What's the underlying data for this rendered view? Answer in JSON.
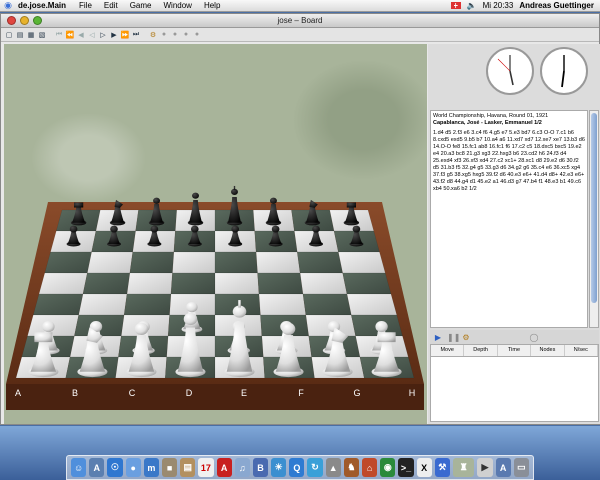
{
  "menubar": {
    "app_name": "de.jose.Main",
    "menus": [
      "File",
      "Edit",
      "Game",
      "Window",
      "Help"
    ],
    "clock": "Mi 20:33",
    "user": "Andreas Guettinger"
  },
  "window": {
    "title": "jose – Board"
  },
  "board": {
    "files": [
      "A",
      "B",
      "C",
      "D",
      "E",
      "F",
      "G",
      "H"
    ]
  },
  "game": {
    "event": "World Championship, Havana, Round 01, 1921",
    "players": "Capablanca, José - Lasker, Emmanuel  1/2",
    "moves": "1.d4 d5 2.f3 e6 3.c4 f6 4.g5 e7 5.e3 bd7 6.c3 O-O 7.c1 b6 8.cxd5 exd5 9.b5 b7 10.a4 a6 11.xd7 xd7 12.xe7 xe7 13.b3 d6 14.O-O fe8 15.fc1 ab8 16.fc1 f6 17.c2 c5 18.dxc5 bxc5 19.e2 e4 20.a3 bc8 21.g3 xg3 22.hxg3 b6 23.cd2 h6 24.f3 d4 25.exd4 xf3 26.xf3 xd4 27.c2 xc1+ 28.xc1 d8 29.e2 d6 30.f2 d5 31.b3 f5 32.g4 g5 33.g3 d6 34.g2 g6 35.c4 e6 36.xc5 xg4 37.f3 g5 38.xg5 hxg5 39.f2 d6 40.e3 e6+ 41.d4 d8+ 42.e3 e6+ 43.f2 d8 44.g4 d1 45.e2 a1 46.d3 g7 47.b4 f1 48.e3 b1 49.c6 xb4 50.xa6 b2  1/2"
  },
  "engine": {
    "columns": [
      "Move",
      "Depth",
      "Time",
      "Nodes",
      "N/sec"
    ]
  }
}
